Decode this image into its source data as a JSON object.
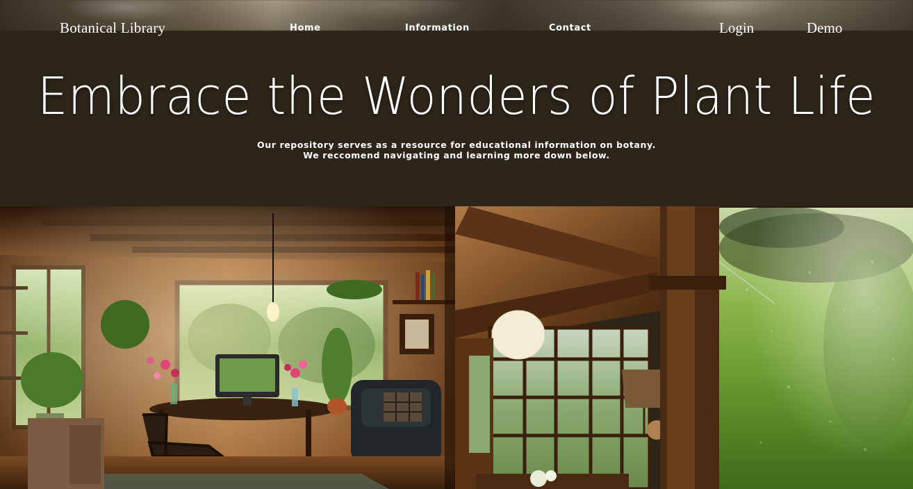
{
  "header": {
    "brand": "Botanical Library",
    "nav": {
      "home": "Home",
      "information": "Information",
      "contact": "Contact",
      "login": "Login",
      "demo": "Demo"
    }
  },
  "hero": {
    "title": "Embrace the Wonders of Plant Life",
    "subtitle_line1": "Our repository serves as a resource for educational information on botany.",
    "subtitle_line2": "We reccomend navigating and learning more down below."
  },
  "gallery": {
    "images": [
      {
        "name": "cabin-study-photo"
      },
      {
        "name": "sunroom-window-photo"
      }
    ]
  },
  "colors": {
    "background": "#2d2519",
    "text": "#ffffff"
  }
}
